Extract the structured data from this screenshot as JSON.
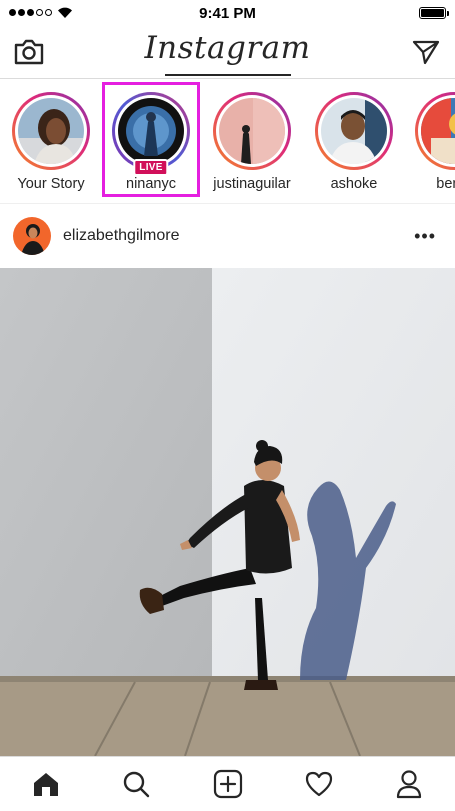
{
  "status_bar": {
    "time": "9:41 PM",
    "signal_bars_filled": 3,
    "signal_bars_total": 5
  },
  "nav": {
    "logo": "Instagram"
  },
  "stories": [
    {
      "name": "Your Story",
      "live": false
    },
    {
      "name": "ninanyc",
      "live": true,
      "badge": "LIVE",
      "highlighted": true
    },
    {
      "name": "justinaguilar",
      "live": false
    },
    {
      "name": "ashoke",
      "live": false
    },
    {
      "name": "benjir",
      "live": false
    }
  ],
  "post": {
    "username": "elizabethgilmore",
    "more_label": "•••"
  },
  "tab_bar": [
    "home-icon",
    "search-icon",
    "add-post-icon",
    "heart-icon",
    "profile-icon"
  ],
  "colors": {
    "live_badge": "#d10f5a",
    "highlight_box": "#e51fe0",
    "ring_start": "#f58529",
    "ring_end": "#8134af"
  }
}
